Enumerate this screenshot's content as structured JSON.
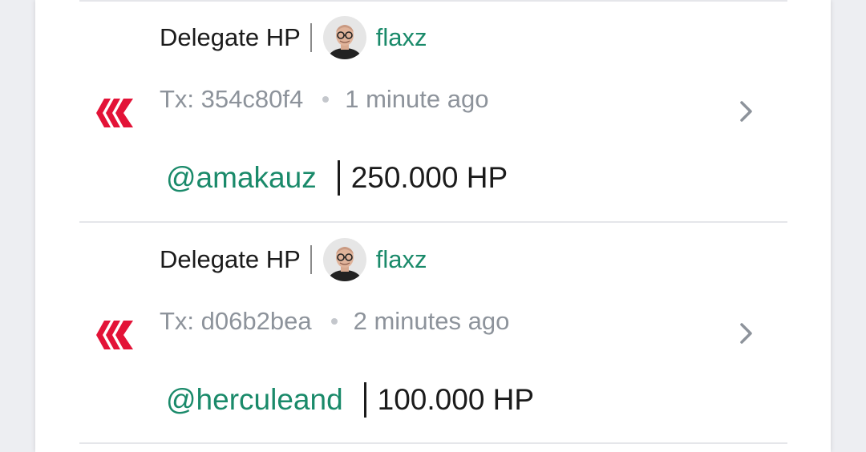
{
  "transactions": [
    {
      "op_type": "Delegate HP",
      "account": "flaxz",
      "tx_label": "Tx: 354c80f4",
      "time_ago": "1 minute ago",
      "delegatee": "@amakauz",
      "amount": "250.000 HP"
    },
    {
      "op_type": "Delegate HP",
      "account": "flaxz",
      "tx_label": "Tx: d06b2bea",
      "time_ago": "2 minutes ago",
      "delegatee": "@herculeand",
      "amount": "100.000 HP"
    }
  ],
  "colors": {
    "account_link": "#1a8a6a",
    "hive_red": "#e31337",
    "muted_text": "#8d939b"
  }
}
